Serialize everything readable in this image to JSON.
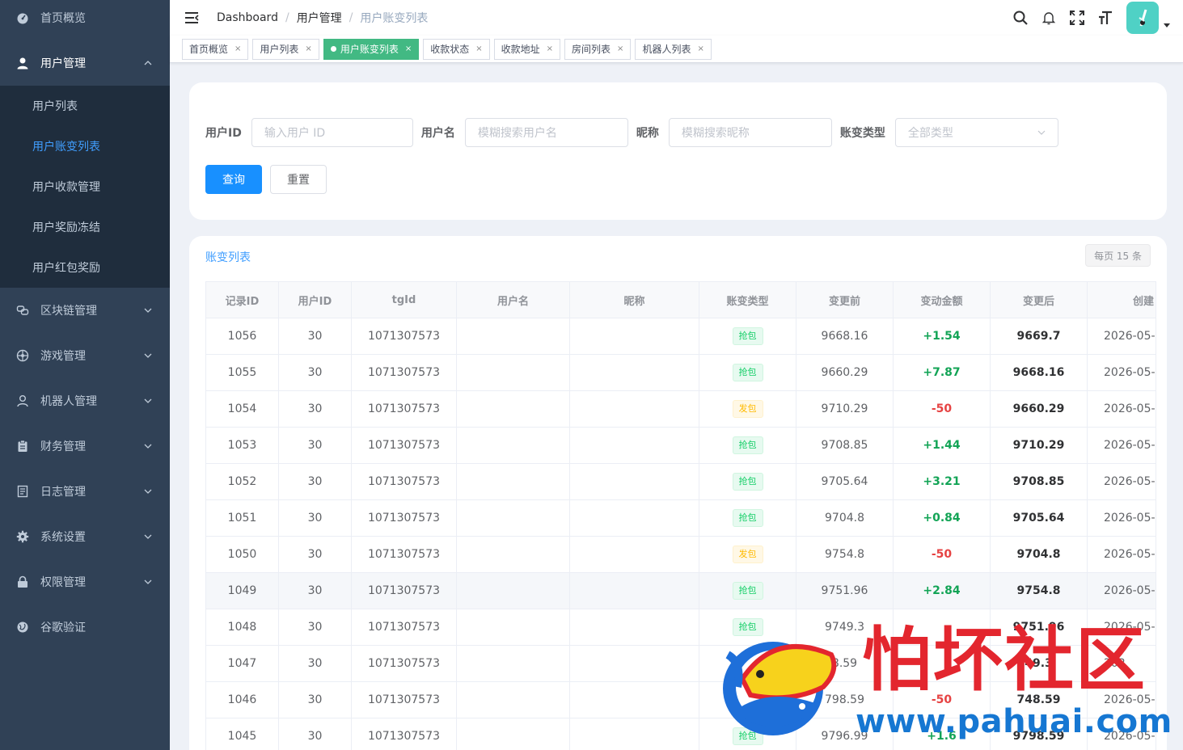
{
  "sidebar": {
    "home": "首页概览",
    "user_mgmt": "用户管理",
    "user_sub": [
      "用户列表",
      "用户账变列表",
      "用户收款管理",
      "用户奖励冻结",
      "用户红包奖励"
    ],
    "groups": [
      "区块链管理",
      "游戏管理",
      "机器人管理",
      "财务管理",
      "日志管理",
      "系统设置",
      "权限管理",
      "谷歌验证"
    ]
  },
  "header": {
    "breadcrumb": [
      "Dashboard",
      "用户管理",
      "用户账变列表"
    ]
  },
  "tags": [
    "首页概览",
    "用户列表",
    "用户账变列表",
    "收款状态",
    "收款地址",
    "房间列表",
    "机器人列表"
  ],
  "search": {
    "user_id_label": "用户ID",
    "user_id_placeholder": "输入用户 ID",
    "username_label": "用户名",
    "username_placeholder": "模糊搜索用户名",
    "nickname_label": "昵称",
    "nickname_placeholder": "模糊搜索昵称",
    "type_label": "账变类型",
    "type_selected": "全部类型",
    "query_btn": "查询",
    "reset_btn": "重置"
  },
  "table": {
    "title": "账变列表",
    "page_size": "每页 15 条",
    "columns": [
      "记录ID",
      "用户ID",
      "tgId",
      "用户名",
      "昵称",
      "账变类型",
      "变更前",
      "变动金额",
      "变更后",
      "创建"
    ],
    "rows": [
      {
        "id": "1056",
        "uid": "30",
        "tg": "1071307573",
        "type": "抢包",
        "kind": "grab",
        "before": "9668.16",
        "amount": "+1.54",
        "after": "9669.7",
        "created": "2026-05-"
      },
      {
        "id": "1055",
        "uid": "30",
        "tg": "1071307573",
        "type": "抢包",
        "kind": "grab",
        "before": "9660.29",
        "amount": "+7.87",
        "after": "9668.16",
        "created": "2026-05-"
      },
      {
        "id": "1054",
        "uid": "30",
        "tg": "1071307573",
        "type": "发包",
        "kind": "send",
        "before": "9710.29",
        "amount": "-50",
        "after": "9660.29",
        "created": "2026-05-"
      },
      {
        "id": "1053",
        "uid": "30",
        "tg": "1071307573",
        "type": "抢包",
        "kind": "grab",
        "before": "9708.85",
        "amount": "+1.44",
        "after": "9710.29",
        "created": "2026-05-"
      },
      {
        "id": "1052",
        "uid": "30",
        "tg": "1071307573",
        "type": "抢包",
        "kind": "grab",
        "before": "9705.64",
        "amount": "+3.21",
        "after": "9708.85",
        "created": "2026-05-"
      },
      {
        "id": "1051",
        "uid": "30",
        "tg": "1071307573",
        "type": "抢包",
        "kind": "grab",
        "before": "9704.8",
        "amount": "+0.84",
        "after": "9705.64",
        "created": "2026-05-"
      },
      {
        "id": "1050",
        "uid": "30",
        "tg": "1071307573",
        "type": "发包",
        "kind": "send",
        "before": "9754.8",
        "amount": "-50",
        "after": "9704.8",
        "created": "2026-05-"
      },
      {
        "id": "1049",
        "uid": "30",
        "tg": "1071307573",
        "type": "抢包",
        "kind": "grab",
        "before": "9751.96",
        "amount": "+2.84",
        "after": "9754.8",
        "created": "2026-05-"
      },
      {
        "id": "1048",
        "uid": "30",
        "tg": "1071307573",
        "type": "抢包",
        "kind": "grab",
        "before": "9749.3",
        "amount": "",
        "after": "9751.96",
        "created": "2026-05-"
      },
      {
        "id": "1047",
        "uid": "30",
        "tg": "1071307573",
        "type": "",
        "kind": "grab",
        "before": "8.59",
        "amount": "",
        "after": "49.3",
        "created": "202"
      },
      {
        "id": "1046",
        "uid": "30",
        "tg": "1071307573",
        "type": "",
        "kind": "send",
        "before": "798.59",
        "amount": "-50",
        "after": "748.59",
        "created": "2026-05-"
      },
      {
        "id": "1045",
        "uid": "30",
        "tg": "1071307573",
        "type": "抢包",
        "kind": "grab",
        "before": "9796.99",
        "amount": "+1.6",
        "after": "9798.59",
        "created": "2026-05-"
      }
    ]
  },
  "watermark": {
    "title": "怕坏社区",
    "url": "www.pahuai.com"
  },
  "colors": {
    "sidebar_bg": "#304156",
    "submenu_bg": "#1f2d3d",
    "primary": "#1890ff",
    "active_tag": "#42b983",
    "positive": "#13a456",
    "negative": "#e64242"
  }
}
